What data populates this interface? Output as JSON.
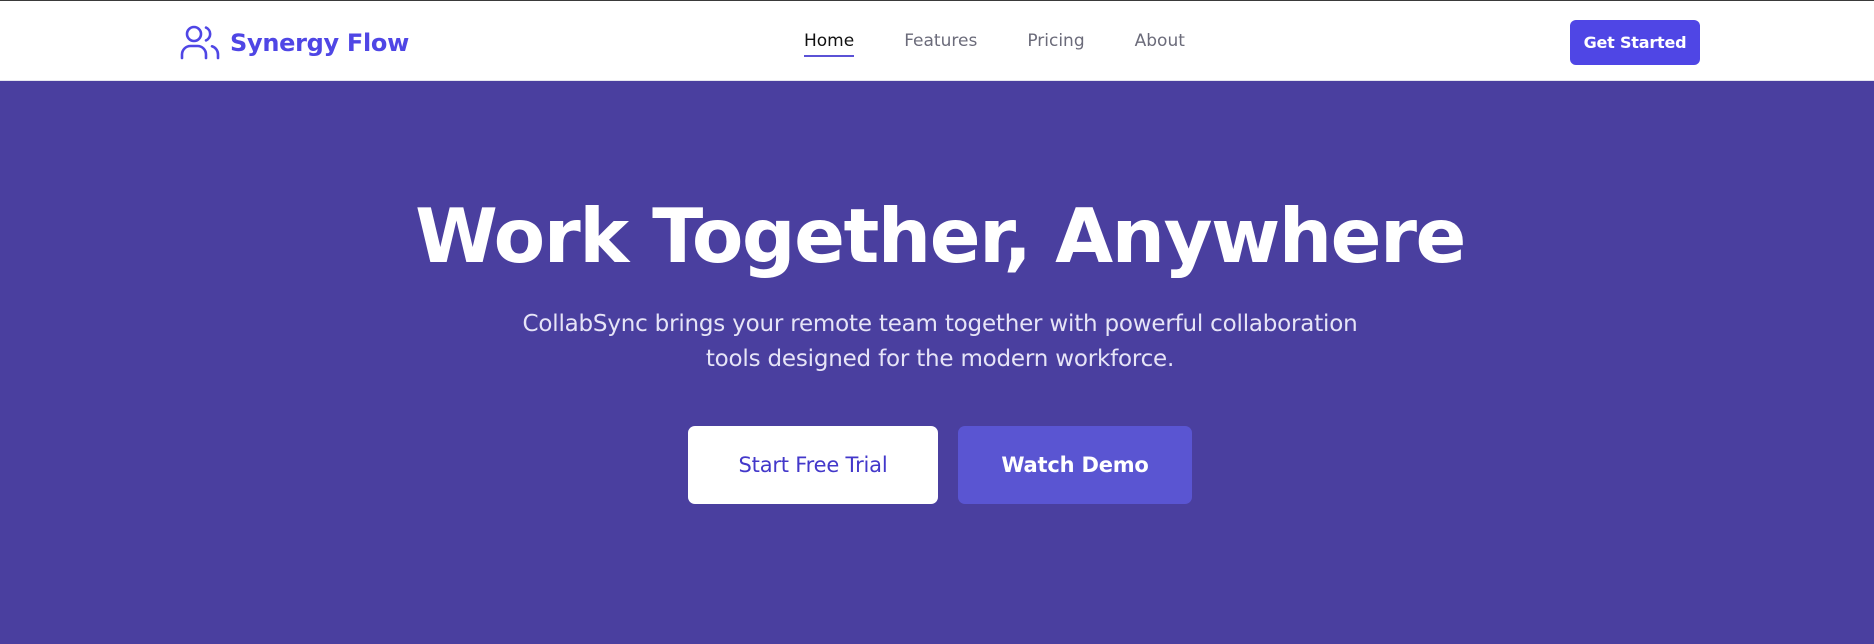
{
  "colors": {
    "brand": "#4f46e5",
    "hero_bg": "#4a3f9f",
    "cta_bg": "#4f46e5",
    "secondary_btn_bg": "#5a55d2",
    "primary_btn_text": "#4338ca"
  },
  "header": {
    "logo_icon": "users-icon",
    "brand_name": "Synergy Flow",
    "nav": [
      {
        "label": "Home",
        "active": true
      },
      {
        "label": "Features",
        "active": false
      },
      {
        "label": "Pricing",
        "active": false
      },
      {
        "label": "About",
        "active": false
      }
    ],
    "cta_label": "Get Started"
  },
  "hero": {
    "title": "Work Together, Anywhere",
    "subtitle": "CollabSync brings your remote team together with powerful collaboration tools designed for the modern workforce.",
    "primary_button": "Start Free Trial",
    "secondary_button": "Watch Demo"
  }
}
